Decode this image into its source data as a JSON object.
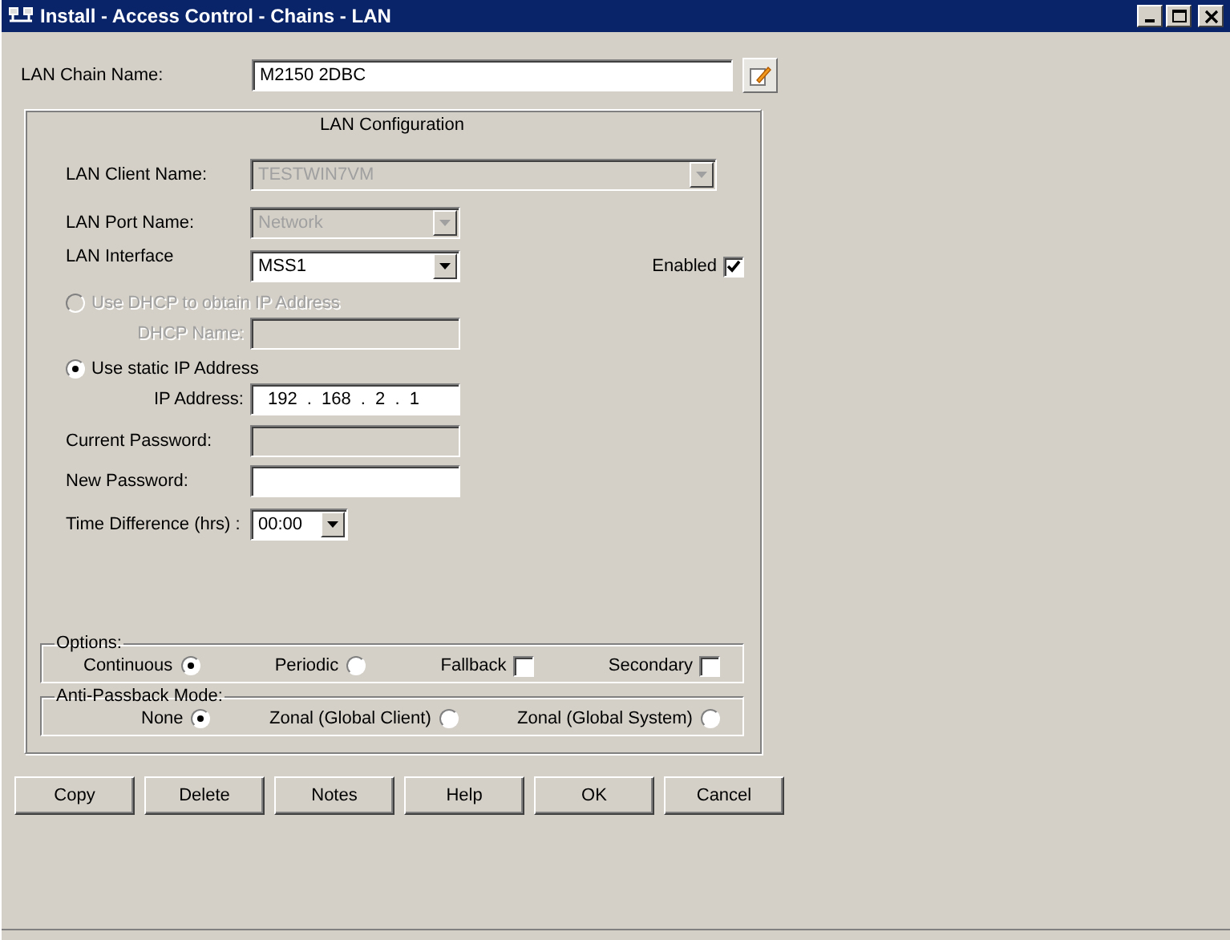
{
  "window": {
    "title": "Install - Access Control - Chains - LAN"
  },
  "chain_name": {
    "label": "LAN Chain Name:",
    "value": "M2150 2DBC"
  },
  "lan_config": {
    "title": "LAN Configuration",
    "client_name": {
      "label": "LAN Client Name:",
      "value": "TESTWIN7VM",
      "disabled": true
    },
    "port_name": {
      "label": "LAN Port Name:",
      "value": "Network",
      "disabled": true
    },
    "interface": {
      "label": "LAN Interface",
      "value": "MSS1",
      "disabled": false
    },
    "enabled": {
      "label": "Enabled",
      "checked": true
    },
    "dhcp": {
      "label": "Use DHCP to obtain IP Address",
      "selected": false,
      "disabled": true
    },
    "dhcp_name": {
      "label": "DHCP Name:",
      "disabled": true
    },
    "static_ip": {
      "label": "Use static IP Address",
      "selected": true,
      "disabled": false
    },
    "ip_address": {
      "label": "IP Address:",
      "value": "192 . 168 . 2 . 1"
    },
    "current_password": {
      "label": "Current Password:",
      "disabled": true
    },
    "new_password": {
      "label": "New Password:",
      "disabled": false
    },
    "time_difference": {
      "label": "Time Difference (hrs) :",
      "value": "00:00"
    }
  },
  "options": {
    "title": "Options:",
    "items": [
      {
        "kind": "radio",
        "label": "Continuous",
        "selected": true
      },
      {
        "kind": "radio",
        "label": "Periodic",
        "selected": false
      },
      {
        "kind": "checkbox",
        "label": "Fallback",
        "checked": false
      },
      {
        "kind": "checkbox",
        "label": "Secondary",
        "checked": false
      }
    ]
  },
  "anti_passback": {
    "title": "Anti-Passback Mode:",
    "items": [
      {
        "label": "None",
        "selected": true
      },
      {
        "label": "Zonal (Global Client)",
        "selected": false
      },
      {
        "label": "Zonal (Global System)",
        "selected": false
      }
    ]
  },
  "buttons": [
    "Copy",
    "Delete",
    "Notes",
    "Help",
    "OK",
    "Cancel"
  ]
}
